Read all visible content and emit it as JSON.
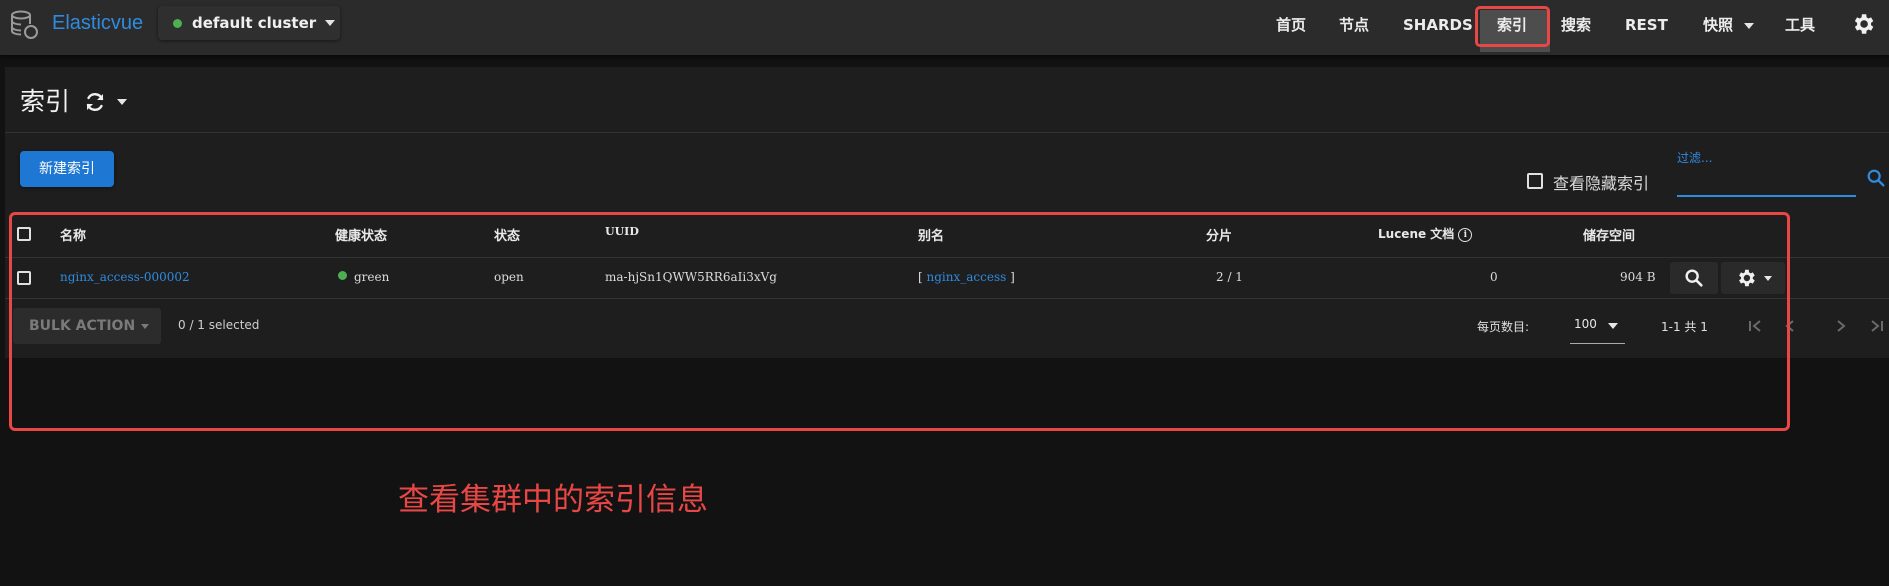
{
  "app": {
    "title": "Elasticvue",
    "logo_icon": "database-icon"
  },
  "cluster": {
    "name": "default cluster",
    "status_color": "#4caf50"
  },
  "nav": {
    "items": [
      "首页",
      "节点",
      "SHARDS",
      "索引",
      "搜索",
      "REST",
      "快照",
      "工具"
    ],
    "active": "索引",
    "settings_icon": "gear-icon"
  },
  "page": {
    "title": "索引",
    "refresh_icon": "refresh-icon"
  },
  "toolbar": {
    "new_index_label": "新建索引",
    "show_hidden_label": "查看隐藏索引",
    "filter_label": "过滤...",
    "filter_value": ""
  },
  "table": {
    "headers": [
      "名称",
      "健康状态",
      "状态",
      "UUID",
      "别名",
      "分片",
      "Lucene 文档",
      "储存空间"
    ],
    "rows": [
      {
        "name": "nginx_access-000002",
        "health": "green",
        "health_color": "#4caf50",
        "status": "open",
        "uuid": "ma-hjSn1QWW5RR6aIi3xVg",
        "alias_open": "[",
        "alias": "nginx_access",
        "alias_close": "]",
        "shards": "2 / 1",
        "docs": "0",
        "size": "904 B"
      }
    ]
  },
  "footer": {
    "bulk_action_label": "BULK ACTION",
    "selected": "0 / 1 selected",
    "rows_per_page_label": "每页数目:",
    "rows_per_page": "100",
    "range": "1-1 共 1"
  },
  "annotation": "查看集群中的索引信息",
  "colors": {
    "accent": "#2f8be0",
    "highlight": "#e84745",
    "button": "#1e77d2"
  }
}
